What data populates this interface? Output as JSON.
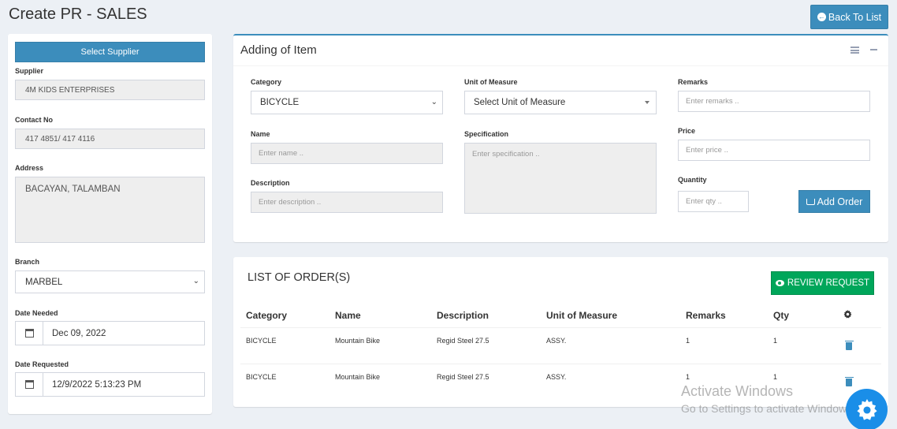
{
  "page": {
    "title": "Create PR - SALES",
    "back_label": "Back To List"
  },
  "left": {
    "select_supplier_label": "Select Supplier",
    "supplier_label": "Supplier",
    "supplier_value": "4M KIDS ENTERPRISES",
    "contact_label": "Contact No",
    "contact_value": "417 4851/ 417 4116",
    "address_label": "Address",
    "address_value": "BACAYAN, TALAMBAN",
    "branch_label": "Branch",
    "branch_value": "MARBEL",
    "date_needed_label": "Date Needed",
    "date_needed_value": "Dec 09, 2022",
    "date_requested_label": "Date Requested",
    "date_requested_value": "12/9/2022 5:13:23 PM"
  },
  "adding": {
    "title": "Adding of Item",
    "category_label": "Category",
    "category_value": "BICYCLE",
    "name_label": "Name",
    "name_placeholder": "Enter name ..",
    "description_label": "Description",
    "description_placeholder": "Enter description ..",
    "uom_label": "Unit of Measure",
    "uom_value": "Select Unit of Measure",
    "spec_label": "Specification",
    "spec_placeholder": "Enter specification ..",
    "remarks_label": "Remarks",
    "remarks_placeholder": "Enter remarks ..",
    "price_label": "Price",
    "price_placeholder": "Enter price ..",
    "qty_label": "Quantity",
    "qty_placeholder": "Enter qty ..",
    "add_order_label": "Add Order"
  },
  "orders": {
    "title": "LIST OF ORDER(S)",
    "review_label": "REVIEW REQUEST",
    "columns": [
      "Category",
      "Name",
      "Description",
      "Unit of Measure",
      "Remarks",
      "Qty"
    ],
    "rows": [
      {
        "category": "BICYCLE",
        "name": "Mountain Bike",
        "description": "Regid Steel 27.5",
        "uom": "ASSY.",
        "remarks": "1",
        "qty": "1"
      },
      {
        "category": "BICYCLE",
        "name": "Mountain Bike",
        "description": "Regid Steel 27.5",
        "uom": "ASSY.",
        "remarks": "1",
        "qty": "1"
      }
    ]
  },
  "watermark": {
    "line1": "Activate Windows",
    "line2": "Go to Settings to activate Windows."
  },
  "colors": {
    "primary": "#3c8dbc",
    "success": "#00a65a",
    "background": "#ecf0f5",
    "fab": "#1a8ee8"
  }
}
